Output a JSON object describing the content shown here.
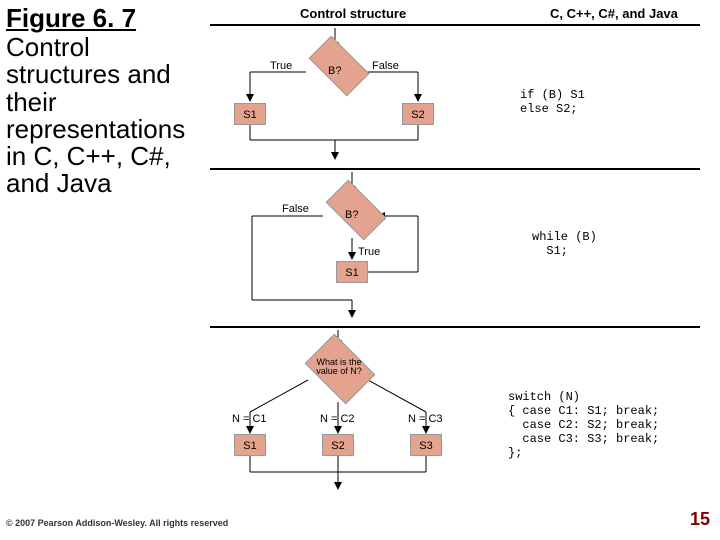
{
  "figure_number": "Figure 6. 7",
  "caption": "Control structures and their representations in C, C++, C#, and Java",
  "copyright": "© 2007 Pearson Addison-Wesley. All rights reserved",
  "page_number": "15",
  "column_headers": {
    "left": "Control structure",
    "right": "C, C++, C#, and Java"
  },
  "rows": [
    {
      "id": "if-else",
      "decision_label": "B?",
      "true_label": "True",
      "false_label": "False",
      "boxes": [
        "S1",
        "S2"
      ],
      "code": "if (B) S1\nelse S2;"
    },
    {
      "id": "while",
      "decision_label": "B?",
      "true_label": "True",
      "false_label": "False",
      "boxes": [
        "S1"
      ],
      "code": "while (B)\n  S1;"
    },
    {
      "id": "switch",
      "decision_label": "What\nis the value\nof N?",
      "branch_labels": [
        "N = C1",
        "N = C2",
        "N = C3"
      ],
      "boxes": [
        "S1",
        "S2",
        "S3"
      ],
      "code": "switch (N)\n{ case C1: S1; break;\n  case C2: S2; break;\n  case C3: S3; break;\n};"
    }
  ]
}
